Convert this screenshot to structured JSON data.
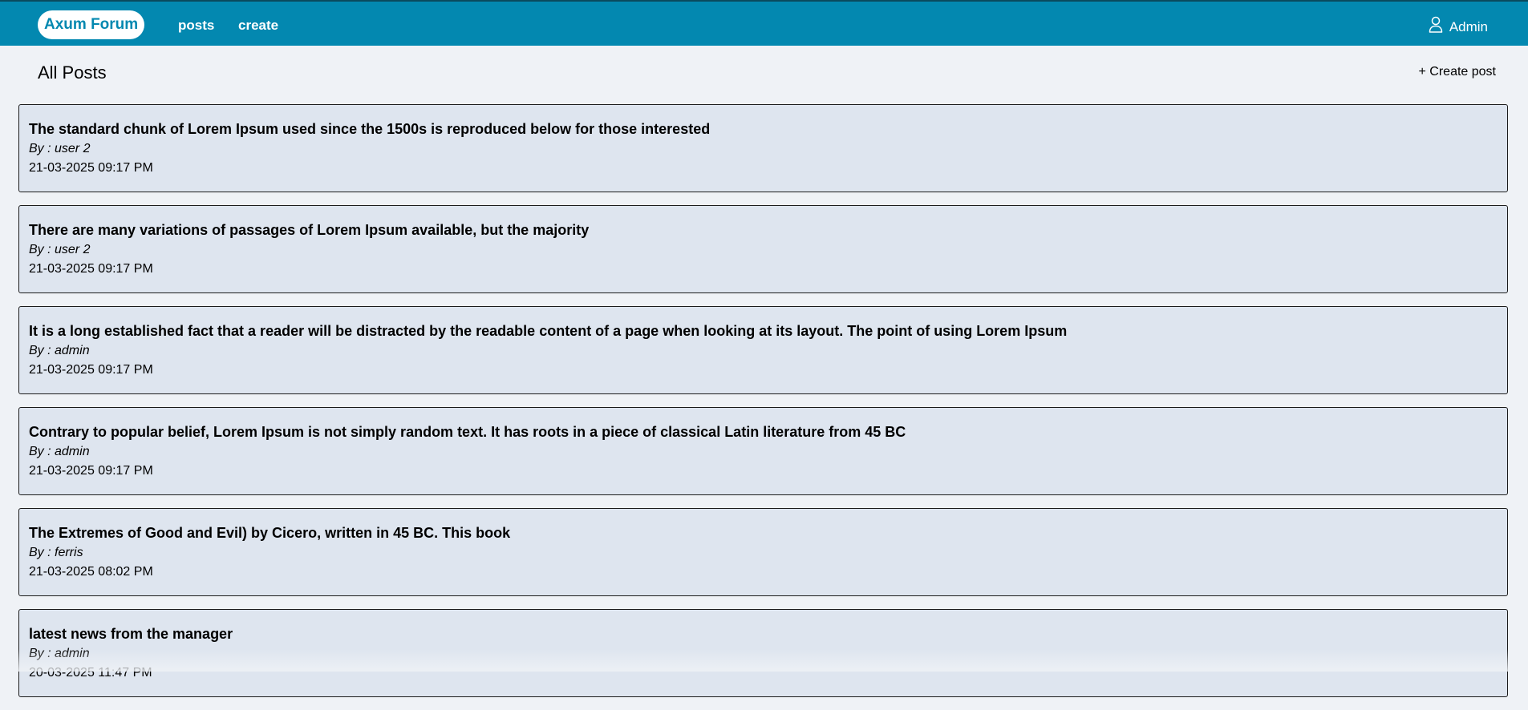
{
  "nav": {
    "brand": "Axum Forum",
    "links": [
      {
        "label": "posts"
      },
      {
        "label": "create"
      }
    ],
    "user": {
      "label": "Admin",
      "icon": "user-icon"
    }
  },
  "main": {
    "title": "All Posts",
    "create_label": "+ Create post",
    "posts": [
      {
        "title": "The standard chunk of Lorem Ipsum used since the 1500s is reproduced below for those interested",
        "author": "By : user 2",
        "date": "21-03-2025 09:17 PM"
      },
      {
        "title": "There are many variations of passages of Lorem Ipsum available, but the majority",
        "author": "By : user 2",
        "date": "21-03-2025 09:17 PM"
      },
      {
        "title": "It is a long established fact that a reader will be distracted by the readable content of a page when looking at its layout. The point of using Lorem Ipsum",
        "author": "By : admin",
        "date": "21-03-2025 09:17 PM"
      },
      {
        "title": "Contrary to popular belief, Lorem Ipsum is not simply random text. It has roots in a piece of classical Latin literature from 45 BC",
        "author": "By : admin",
        "date": "21-03-2025 09:17 PM"
      },
      {
        "title": "The Extremes of Good and Evil) by Cicero, written in 45 BC. This book",
        "author": "By : ferris",
        "date": "21-03-2025 08:02 PM"
      },
      {
        "title": "latest news from the manager",
        "author": "By : admin",
        "date": "20-03-2025 11:47 PM"
      }
    ]
  },
  "colors": {
    "header": "#0388b0",
    "background": "#eff2f6",
    "card": "#dee5ef"
  }
}
